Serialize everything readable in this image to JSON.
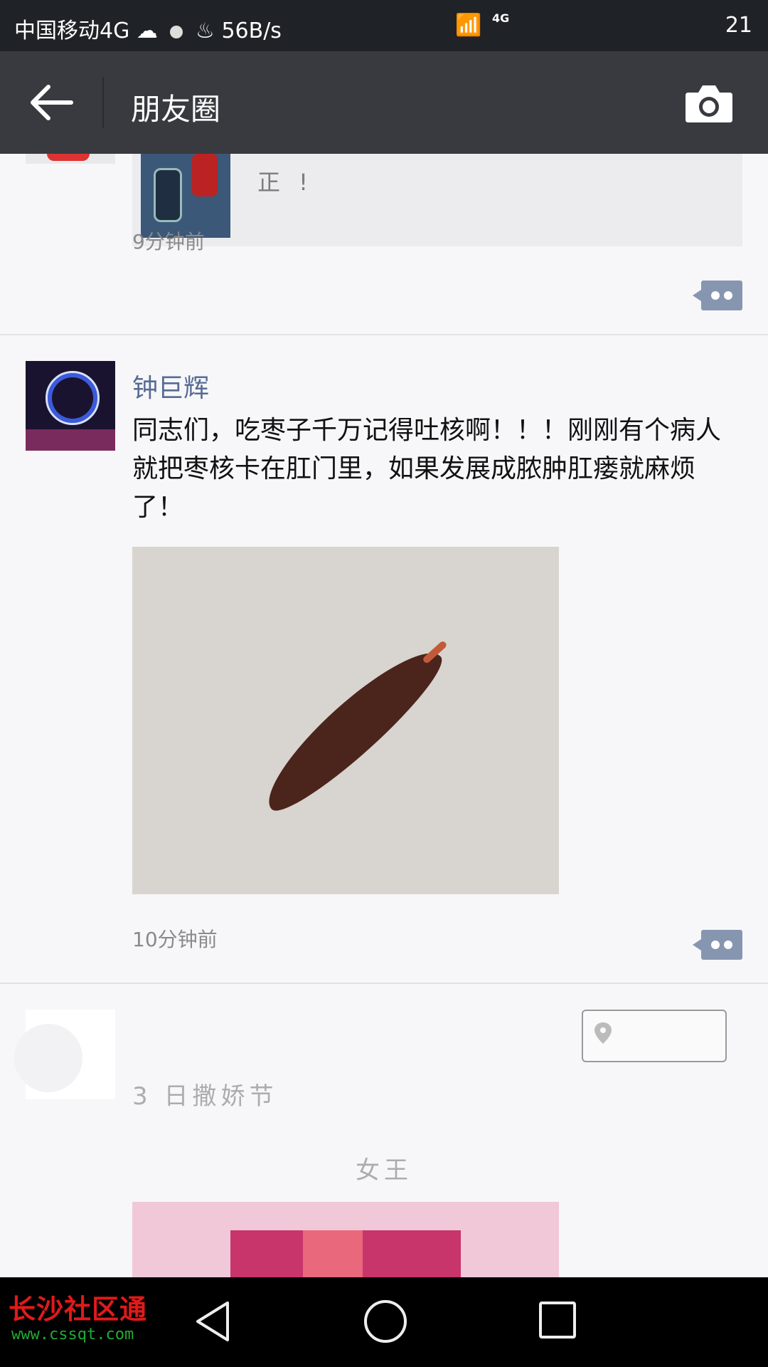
{
  "status_bar": {
    "carrier": "中国移动4G",
    "speed": "56B/s",
    "network": "4G",
    "time": "21"
  },
  "app_bar": {
    "title": "朋友圈",
    "back_icon": "arrow-left-icon",
    "camera_icon": "camera-icon"
  },
  "posts": [
    {
      "share_text": "正 !",
      "time": "9分钟前"
    },
    {
      "author": "钟巨辉",
      "text": "同志们，吃枣子千万记得吐核啊！！！刚刚有个病人就把枣核卡在肛门里，如果发展成脓肿肛瘘就麻烦了！",
      "time": "10分钟前"
    },
    {
      "lines": [
        "3 日撒娇节",
        "女王"
      ]
    }
  ],
  "watermark": {
    "name": "长沙社区通",
    "url": "www.cssqt.com"
  },
  "colors": {
    "app_bar": "#393a3f",
    "author_link": "#576b95",
    "comment_button": "#8796b0"
  }
}
